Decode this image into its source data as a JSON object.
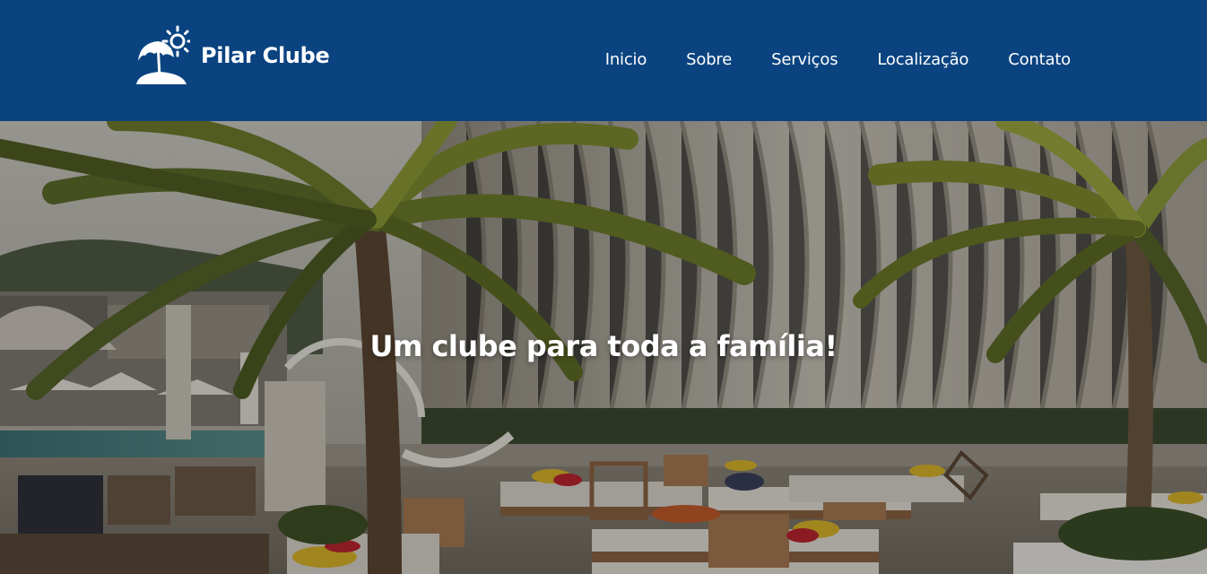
{
  "brand": {
    "name": "Pilar Clube",
    "icon": "beach-umbrella-sun-icon"
  },
  "nav": {
    "items": [
      {
        "label": "Inicio"
      },
      {
        "label": "Sobre"
      },
      {
        "label": "Serviços"
      },
      {
        "label": "Localização"
      },
      {
        "label": "Contato"
      }
    ]
  },
  "hero": {
    "title": "Um clube para toda a família!",
    "image": "pool-resort-palm-trees-photo"
  },
  "colors": {
    "header_bg": "#0a4380",
    "text": "#ffffff"
  }
}
